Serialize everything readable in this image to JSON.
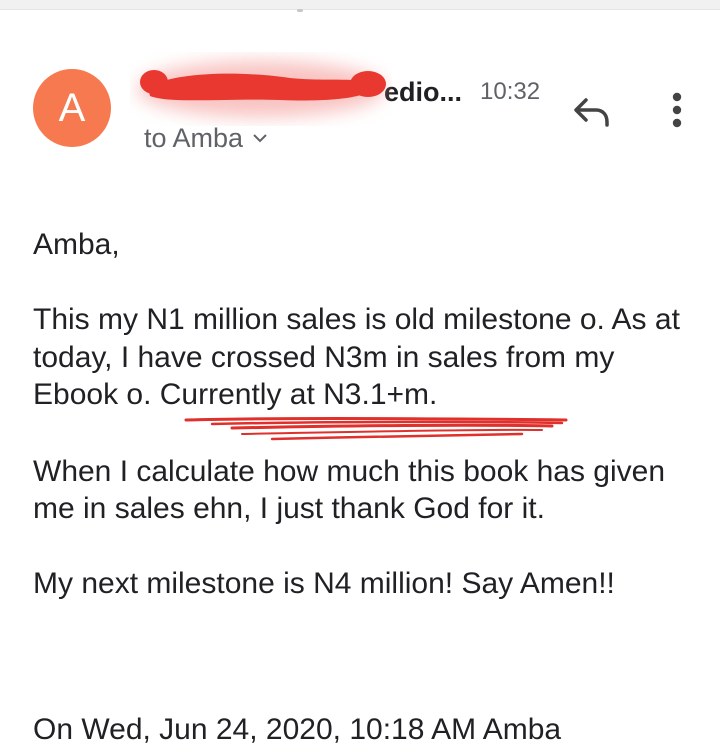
{
  "message": {
    "avatar_letter": "A",
    "sender_name_visible": "edio...",
    "time": "10:32",
    "recipient": "to Amba",
    "body": {
      "greeting": "Amba,",
      "paragraph1": "This my N1 million sales is old milestone o. As at today, I have crossed N3m in sales from my Ebook o. Currently at N3.1+m.",
      "paragraph2": "When I calculate how much this book has given me in sales ehn, I just thank God for it.",
      "paragraph3": "My next milestone is N4 million!  Say Amen!!"
    },
    "quoted_header_partial": "On Wed, Jun 24, 2020, 10:18 AM Amba"
  },
  "icons": {
    "reply": "reply-icon",
    "more": "more-vert-icon",
    "expand": "chevron-down-icon"
  },
  "colors": {
    "avatar": "#f6794f",
    "redaction": "#e8382f",
    "underline_annotation": "#e0302c",
    "secondary_text": "#5f6368"
  }
}
